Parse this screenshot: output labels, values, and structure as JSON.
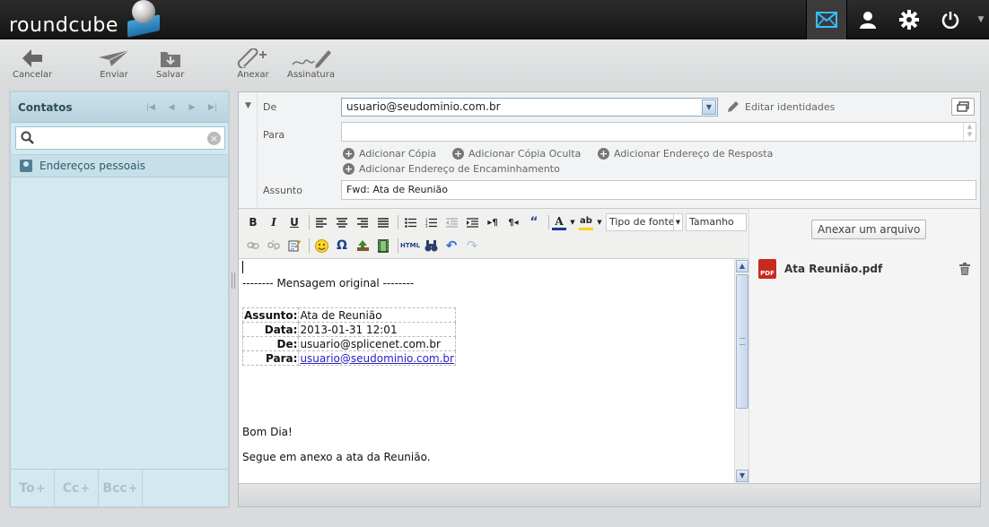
{
  "app": {
    "logo_text": "roundcube",
    "accent": "#37beff"
  },
  "topnav": {
    "items": [
      {
        "name": "mail",
        "icon": "envelope-icon"
      },
      {
        "name": "contacts",
        "icon": "user-icon"
      },
      {
        "name": "settings",
        "icon": "gear-icon"
      },
      {
        "name": "logout",
        "icon": "power-icon"
      }
    ]
  },
  "toolbar": {
    "cancel": "Cancelar",
    "send": "Enviar",
    "save": "Salvar",
    "attach": "Anexar",
    "signature": "Assinatura"
  },
  "contacts": {
    "title": "Contatos",
    "search_value": "",
    "addressbook": "Endereços pessoais",
    "recipient_buttons": [
      "To",
      "Cc",
      "Bcc"
    ]
  },
  "compose": {
    "from_label": "De",
    "from_value": "usuario@seudominio.com.br",
    "edit_identities": "Editar identidades",
    "to_label": "Para",
    "to_value": "",
    "add_cc": "Adicionar Cópia",
    "add_bcc": "Adicionar Cópia Oculta",
    "add_reply_to": "Adicionar Endereço de Resposta",
    "add_followup_to": "Adicionar Endereço de Encaminhamento",
    "subject_label": "Assunto",
    "subject_value": "Fwd: Ata de Reunião"
  },
  "editor": {
    "font_placeholder": "Tipo de fonte",
    "size_placeholder": "Tamanho",
    "html_label": "HTML",
    "original_message_line": "-------- Mensagem original --------",
    "original": {
      "subject_key": "Assunto:",
      "subject_val": "Ata de Reunião",
      "date_key": "Data:",
      "date_val": "2013-01-31 12:01",
      "from_key": "De:",
      "from_val": "usuario@splicenet.com.br",
      "to_key": "Para:",
      "to_val": "usuario@seudominio.com.br"
    },
    "greeting": "Bom Dia!",
    "body": "Segue em anexo a ata da Reunião."
  },
  "attachments": {
    "button": "Anexar um arquivo",
    "items": [
      {
        "name": "Ata Reunião.pdf",
        "type_label": "PDF"
      }
    ]
  }
}
